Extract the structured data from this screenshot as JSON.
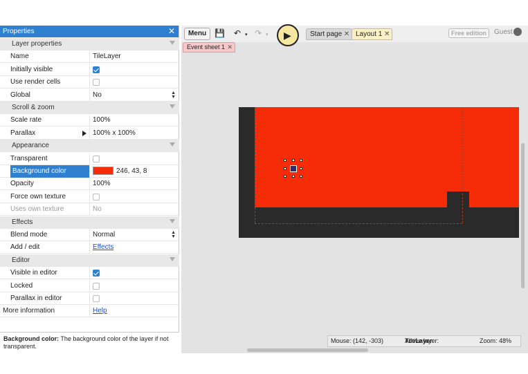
{
  "properties": {
    "title": "Properties",
    "close_glyph": "✕",
    "rows": [
      {
        "kind": "category",
        "label": "Layer properties"
      },
      {
        "kind": "text",
        "label": "Name",
        "value": "TileLayer"
      },
      {
        "kind": "check",
        "label": "Initially visible",
        "checked": true
      },
      {
        "kind": "check",
        "label": "Use render cells",
        "checked": false
      },
      {
        "kind": "dropdown",
        "label": "Global",
        "value": "No"
      },
      {
        "kind": "category",
        "label": "Scroll & zoom"
      },
      {
        "kind": "text",
        "label": "Scale rate",
        "value": "100%"
      },
      {
        "kind": "expand",
        "label": "Parallax",
        "value": "100% x 100%"
      },
      {
        "kind": "category",
        "label": "Appearance"
      },
      {
        "kind": "check",
        "label": "Transparent",
        "checked": false
      },
      {
        "kind": "color",
        "label": "Background color",
        "value": "246, 43, 8",
        "color": "#f62b08",
        "selected": true
      },
      {
        "kind": "text",
        "label": "Opacity",
        "value": "100%"
      },
      {
        "kind": "check",
        "label": "Force own texture",
        "checked": false
      },
      {
        "kind": "text",
        "label": "Uses own texture",
        "value": "No",
        "disabled": true
      },
      {
        "kind": "category",
        "label": "Effects"
      },
      {
        "kind": "dropdown",
        "label": "Blend mode",
        "value": "Normal"
      },
      {
        "kind": "link",
        "label": "Add / edit",
        "value": "Effects"
      },
      {
        "kind": "category",
        "label": "Editor"
      },
      {
        "kind": "check",
        "label": "Visible in editor",
        "checked": true
      },
      {
        "kind": "check",
        "label": "Locked",
        "checked": false
      },
      {
        "kind": "check",
        "label": "Parallax in editor",
        "checked": false
      },
      {
        "kind": "link",
        "label": "More information",
        "value": "Help",
        "flush": true
      }
    ],
    "description": {
      "title": "Background color:",
      "text": " The background color of the layer if not transparent."
    }
  },
  "toolbar": {
    "menu_label": "Menu",
    "free_edition": "Free edition",
    "guest": "Guest",
    "icons": [
      "save-icon",
      "undo-icon",
      "redo-icon",
      "pointer-icon",
      "user-icon"
    ]
  },
  "tabs": {
    "start_page": "Start page",
    "layout": "Layout 1",
    "event_sheet": "Event sheet 1",
    "close_glyph": "✕"
  },
  "status": {
    "mouse": "Mouse: (142, -303)",
    "active_layer_label": "Active layer: ",
    "active_layer": "TileLayer",
    "zoom": "Zoom: 48%"
  },
  "colors": {
    "accent": "#2f80d0",
    "layer_background": "#f62b08",
    "layout_dark": "#2a2a2a"
  }
}
